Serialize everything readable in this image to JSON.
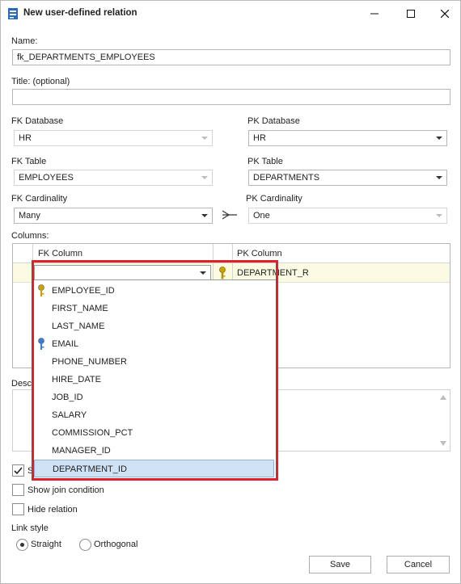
{
  "window": {
    "title": "New user-defined relation",
    "minimize_icon": "minimize-icon",
    "maximize_icon": "maximize-icon",
    "close_icon": "close-icon"
  },
  "name": {
    "label": "Name:",
    "value": "fk_DEPARTMENTS_EMPLOYEES"
  },
  "title_field": {
    "label": "Title: (optional)",
    "value": ""
  },
  "fk_database": {
    "label": "FK Database",
    "value": "HR"
  },
  "pk_database": {
    "label": "PK Database",
    "value": "HR"
  },
  "fk_table": {
    "label": "FK Table",
    "value": "EMPLOYEES"
  },
  "pk_table": {
    "label": "PK Table",
    "value": "DEPARTMENTS"
  },
  "fk_cardinality": {
    "label": "FK Cardinality",
    "value": "Many"
  },
  "pk_cardinality": {
    "label": "PK Cardinality",
    "value": "One"
  },
  "columns": {
    "label": "Columns:",
    "headers": [
      "FK Column",
      "PK Column"
    ],
    "row": {
      "fk_value": "",
      "pk_value": "DEPARTMENT_R"
    }
  },
  "dropdown": {
    "items": [
      {
        "label": "EMPLOYEE_ID",
        "key": "primary"
      },
      {
        "label": "FIRST_NAME",
        "key": ""
      },
      {
        "label": "LAST_NAME",
        "key": ""
      },
      {
        "label": "EMAIL",
        "key": "unique"
      },
      {
        "label": "PHONE_NUMBER",
        "key": ""
      },
      {
        "label": "HIRE_DATE",
        "key": ""
      },
      {
        "label": "JOB_ID",
        "key": ""
      },
      {
        "label": "SALARY",
        "key": ""
      },
      {
        "label": "COMMISSION_PCT",
        "key": ""
      },
      {
        "label": "MANAGER_ID",
        "key": ""
      },
      {
        "label": "DEPARTMENT_ID",
        "key": ""
      }
    ],
    "selected": "DEPARTMENT_ID"
  },
  "description": {
    "label_partial": "Desc"
  },
  "options": {
    "show_partial": "S",
    "show_join_condition": "Show join condition",
    "hide_relation": "Hide relation"
  },
  "link_style": {
    "label": "Link style",
    "straight": "Straight",
    "orthogonal": "Orthogonal",
    "selected": "Straight"
  },
  "buttons": {
    "save": "Save",
    "cancel": "Cancel"
  },
  "colors": {
    "highlight_border": "#e0202a",
    "selected_row": "#cfe2f6",
    "key_gold": "#c9a400",
    "key_blue": "#3a7bd5"
  }
}
